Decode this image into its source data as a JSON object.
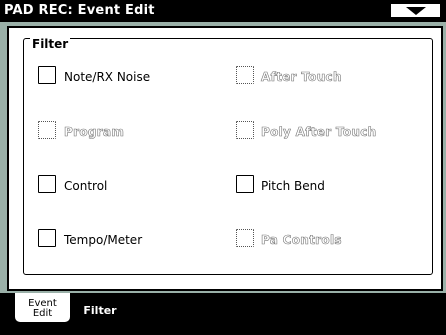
{
  "title": "PAD REC: Event Edit",
  "menu_icon": "down-triangle-icon",
  "filter": {
    "label": "Filter",
    "items": [
      {
        "label": "Note/RX Noise",
        "enabled": true
      },
      {
        "label": "After Touch",
        "enabled": false
      },
      {
        "label": "Program",
        "enabled": false
      },
      {
        "label": "Poly After Touch",
        "enabled": false
      },
      {
        "label": "Control",
        "enabled": true
      },
      {
        "label": "Pitch Bend",
        "enabled": true
      },
      {
        "label": "Tempo/Meter",
        "enabled": true
      },
      {
        "label": "Pa Controls",
        "enabled": false
      }
    ]
  },
  "tabs": [
    {
      "label_line1": "Event",
      "label_line2": "Edit"
    },
    {
      "label": "Filter"
    }
  ]
}
